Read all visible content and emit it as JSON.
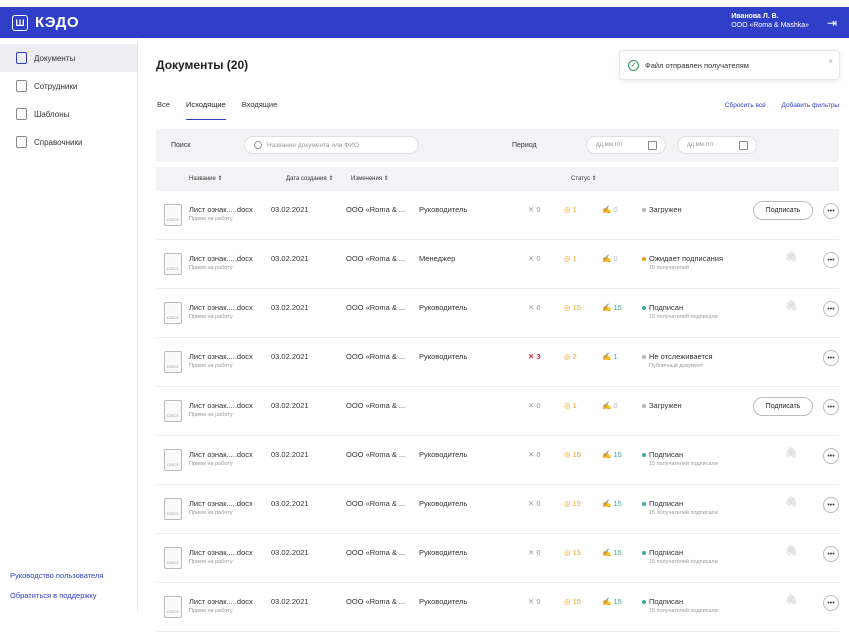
{
  "app": {
    "logo_mark": "Ш",
    "name": "КЭДО",
    "logout_icon": "logout-icon",
    "accent": "#2f3fc8"
  },
  "user": {
    "name": "Иванова Л. В.",
    "org": "ООО «Roma & Mashka»"
  },
  "sidebar": {
    "items": [
      {
        "label": "Документы",
        "icon": "documents-icon",
        "active": true
      },
      {
        "label": "Сотрудники",
        "icon": "employees-icon",
        "active": false
      },
      {
        "label": "Шаблоны",
        "icon": "templates-icon",
        "active": false
      },
      {
        "label": "Справочники",
        "icon": "directories-icon",
        "active": false
      }
    ],
    "guide_link": "Руководство пользователя",
    "support_link": "Обратиться в поддержку"
  },
  "page": {
    "title": "Документы (20)"
  },
  "toast": {
    "text": "Файл отправлен получателям",
    "close": "×"
  },
  "tabs": [
    {
      "label": "Все",
      "active": false
    },
    {
      "label": "Исходящие",
      "active": true
    },
    {
      "label": "Входящие",
      "active": false
    }
  ],
  "actions": {
    "reset": "Сбросить всё",
    "add_filters": "Добавить фильтры"
  },
  "filters": {
    "search_label": "Поиск",
    "search_placeholder": "Название документа или ФИО",
    "period_label": "Период",
    "date_from_placeholder": "дд.мм.гггг",
    "date_to_placeholder": "дд.мм.гггг"
  },
  "table": {
    "headers": {
      "name": "Название  ⇕",
      "created": "Дата создания  ⇕",
      "changes": "Изменения  ⇕",
      "status": "Статус  ⇕"
    },
    "sign_label": "Подписать",
    "rows": [
      {
        "file": "Лист ознак.....docx",
        "sub": "Прием на работу",
        "date": "03.02.2021",
        "org": "ООО «Roma & ...",
        "role": "Руководитель",
        "rejected": "0",
        "viewed": "1",
        "signed": "0",
        "status": "Загружен",
        "status_sub": "",
        "status_color": "#b5b5bb",
        "action": "sign"
      },
      {
        "file": "Лист ознак.....docx",
        "sub": "Прием на работу",
        "date": "03.02.2021",
        "org": "ООО «Roma & ...",
        "role": "Менеджер",
        "rejected": "0",
        "viewed": "1",
        "signed": "0",
        "status": "Ожидает подписания",
        "status_sub": "15 получателей",
        "status_color": "#e8a317",
        "action": "clip"
      },
      {
        "file": "Лист ознак.....docx",
        "sub": "Прием на работу",
        "date": "03.02.2021",
        "org": "ООО «Roma & ...",
        "role": "Руководитель",
        "rejected": "0",
        "viewed": "15",
        "signed": "15",
        "status": "Подписан",
        "status_sub": "15 получателей подписали",
        "status_color": "#3da8a0",
        "action": "clip"
      },
      {
        "file": "Лист ознак.....docx",
        "sub": "Прием на работу",
        "date": "03.02.2021",
        "org": "ООО «Roma & ...",
        "role": "Руководитель",
        "rejected": "3",
        "viewed": "2",
        "signed": "1",
        "status": "Не отслеживается",
        "status_sub": "Публичный документ",
        "status_color": "#b5b5bb",
        "action": "none"
      },
      {
        "file": "Лист ознак.....docx",
        "sub": "Прием на работу",
        "date": "03.02.2021",
        "org": "ООО «Roma & ...",
        "role": "",
        "rejected": "0",
        "viewed": "1",
        "signed": "0",
        "status": "Загружен",
        "status_sub": "",
        "status_color": "#b5b5bb",
        "action": "sign"
      },
      {
        "file": "Лист ознак.....docx",
        "sub": "Прием на работу",
        "date": "03.02.2021",
        "org": "ООО «Roma & ...",
        "role": "Руководитель",
        "rejected": "0",
        "viewed": "15",
        "signed": "15",
        "status": "Подписан",
        "status_sub": "15 получателей подписали",
        "status_color": "#3da8a0",
        "action": "clip"
      },
      {
        "file": "Лист ознак.....docx",
        "sub": "Прием на работу",
        "date": "03.02.2021",
        "org": "ООО «Roma & ...",
        "role": "Руководитель",
        "rejected": "0",
        "viewed": "15",
        "signed": "15",
        "status": "Подписан",
        "status_sub": "15 получателей подписали",
        "status_color": "#3da8a0",
        "action": "clip"
      },
      {
        "file": "Лист ознак.....docx",
        "sub": "Прием на работу",
        "date": "03.02.2021",
        "org": "ООО «Roma & ...",
        "role": "Руководитель",
        "rejected": "0",
        "viewed": "15",
        "signed": "15",
        "status": "Подписан",
        "status_sub": "15 получателей подписали",
        "status_color": "#3da8a0",
        "action": "clip"
      },
      {
        "file": "Лист ознак.....docx",
        "sub": "Прием на работу",
        "date": "03.02.2021",
        "org": "ООО «Roma & ...",
        "role": "Руководитель",
        "rejected": "0",
        "viewed": "15",
        "signed": "15",
        "status": "Подписан",
        "status_sub": "15 получателей подписали",
        "status_color": "#3da8a0",
        "action": "clip"
      }
    ]
  }
}
